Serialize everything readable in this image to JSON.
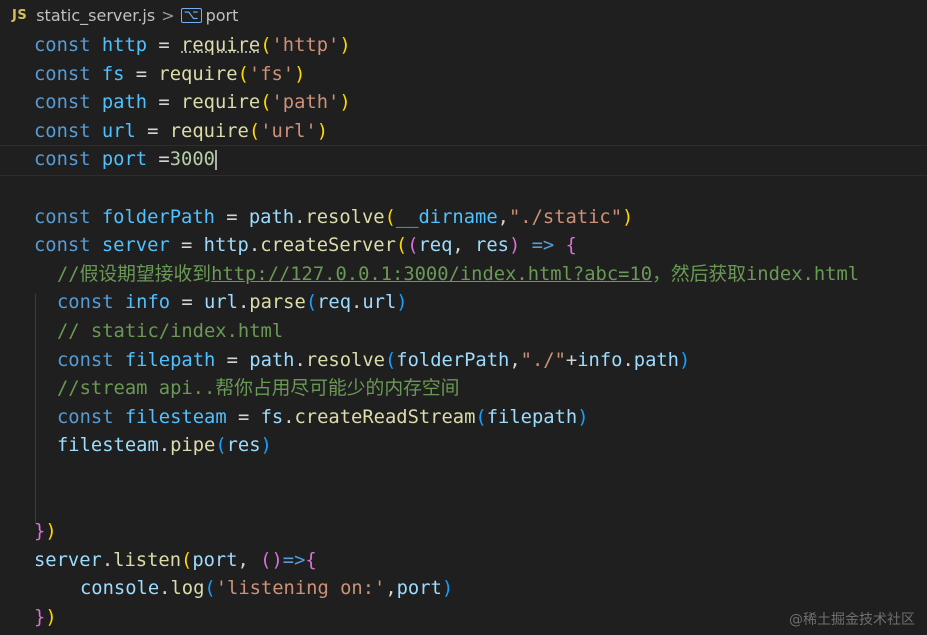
{
  "breadcrumb": {
    "language_badge": "JS",
    "file_name": "static_server.js",
    "separator": ">",
    "symbol_icon": "variable-icon",
    "symbol_name": "port"
  },
  "code_lines": [
    "const http = require('http')",
    "const fs = require('fs')",
    "const path = require('path')",
    "const url = require('url')",
    "const port =3000",
    "",
    "const folderPath = path.resolve(__dirname,\"./static\")",
    "const server = http.createServer((req, res) => {",
    "//假设期望接收到http://127.0.0.1:3000/index.html?abc=10，然后获取index.html",
    "const info = url.parse(req.url)",
    "// static/index.html",
    "const filepath = path.resolve(folderPath,\"./\"+info.path)",
    "//stream api..帮你占用尽可能少的内存空间",
    "const filesteam = fs.createReadStream(filepath)",
    "filesteam.pipe(res)",
    "",
    "",
    "})",
    "server.listen(port, ()=>{",
    "console.log('listening on:',port)",
    "})"
  ],
  "tokens": {
    "const": "const",
    "require": "require",
    "http": "http",
    "fs": "fs",
    "path": "path",
    "url": "url",
    "port": "port",
    "s_http": "'http'",
    "s_fs": "'fs'",
    "s_path": "'path'",
    "s_url": "'url'",
    "n3000": "3000",
    "folderPath": "folderPath",
    "resolve": "resolve",
    "dirname": "__dirname",
    "s_static": "\"./static\"",
    "server": "server",
    "createServer": "createServer",
    "req": "req",
    "res": "res",
    "comment1_pre": "//假设期望接收到",
    "comment1_link": "http://127.0.0.1:3000/index.html?abc=10",
    "comment1_post": "，然后获取index.html",
    "info": "info",
    "parse": "parse",
    "comment2": "// static/index.html",
    "filepath": "filepath",
    "s_dot": "\"./\"",
    "comment3": "//stream api..帮你占用尽可能少的内存空间",
    "filesteam": "filesteam",
    "createReadStream": "createReadStream",
    "pipe": "pipe",
    "listen": "listen",
    "console": "console",
    "log": "log",
    "s_listening": "'listening on:'"
  },
  "colors": {
    "background": "#1f1f1f",
    "keyword": "#569cd6",
    "variable": "#4fc1ff",
    "function": "#dcdcaa",
    "string": "#ce9178",
    "number": "#b5cea8",
    "comment": "#6a9955",
    "parameter": "#9cdcfe"
  },
  "watermark": "@稀土掘金技术社区"
}
